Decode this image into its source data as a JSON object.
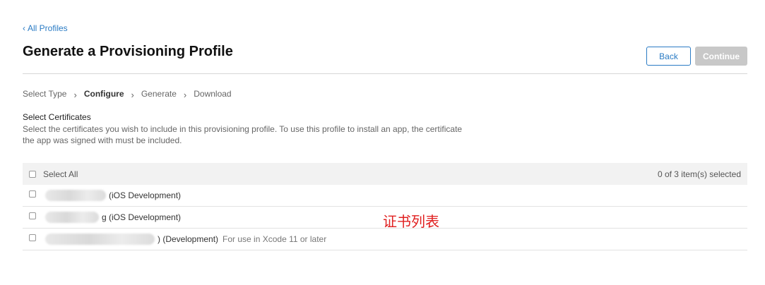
{
  "nav": {
    "back_chevron": "‹",
    "back_label": "All Profiles"
  },
  "header": {
    "title": "Generate a Provisioning Profile"
  },
  "actions": {
    "back_label": "Back",
    "continue_label": "Continue"
  },
  "steps": [
    {
      "label": "Select Type",
      "active": false
    },
    {
      "label": "Configure",
      "active": true
    },
    {
      "label": "Generate",
      "active": false
    },
    {
      "label": "Download",
      "active": false
    }
  ],
  "step_separator": "›",
  "certificates": {
    "title": "Select Certificates",
    "description": "Select the certificates you wish to include in this provisioning profile. To use this profile to install an app, the certificate the app was signed with must be included.",
    "select_all_label": "Select All",
    "selected_count_text": "0 of 3 item(s) selected",
    "rows": [
      {
        "name_suffix": "(iOS Development)",
        "note": ""
      },
      {
        "name_suffix": "g (iOS Development)",
        "note": ""
      },
      {
        "name_suffix": ") (Development)",
        "note": "For use in Xcode 11 or later"
      }
    ]
  },
  "annotation": {
    "text": "证书列表",
    "color": "#e02020"
  },
  "colors": {
    "accent": "#2a7bc4",
    "disabled": "#c8c8c8"
  }
}
